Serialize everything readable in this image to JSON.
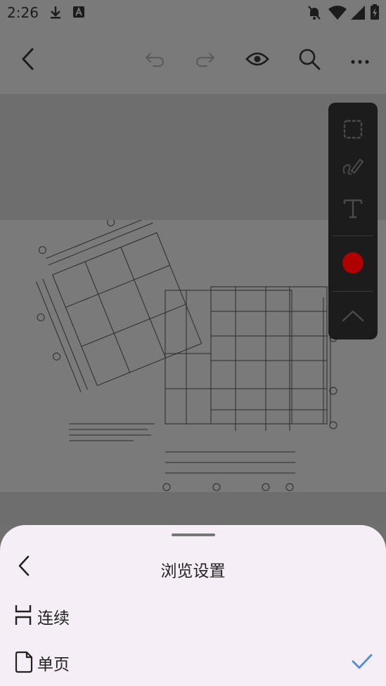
{
  "status_bar": {
    "time": "2:26",
    "icons": [
      "download-icon",
      "font-a-icon",
      "notifications-off-icon",
      "wifi-icon",
      "signal-icon",
      "battery-icon"
    ]
  },
  "toolbar": {
    "icons": [
      "back-arrow-icon",
      "undo-icon",
      "redo-icon",
      "eye-icon",
      "search-icon",
      "more-icon"
    ]
  },
  "tool_panel": {
    "icons": [
      "lasso-select-icon",
      "pen-icon",
      "text-icon",
      "color-dot-icon",
      "chevron-up-icon"
    ],
    "color": "#b10000"
  },
  "sheet": {
    "title": "浏览设置",
    "options": [
      {
        "label": "连续",
        "icon": "continuous-scroll-icon",
        "selected": false
      },
      {
        "label": "单页",
        "icon": "single-page-icon",
        "selected": true
      }
    ],
    "accent": "#4f8cd8"
  }
}
